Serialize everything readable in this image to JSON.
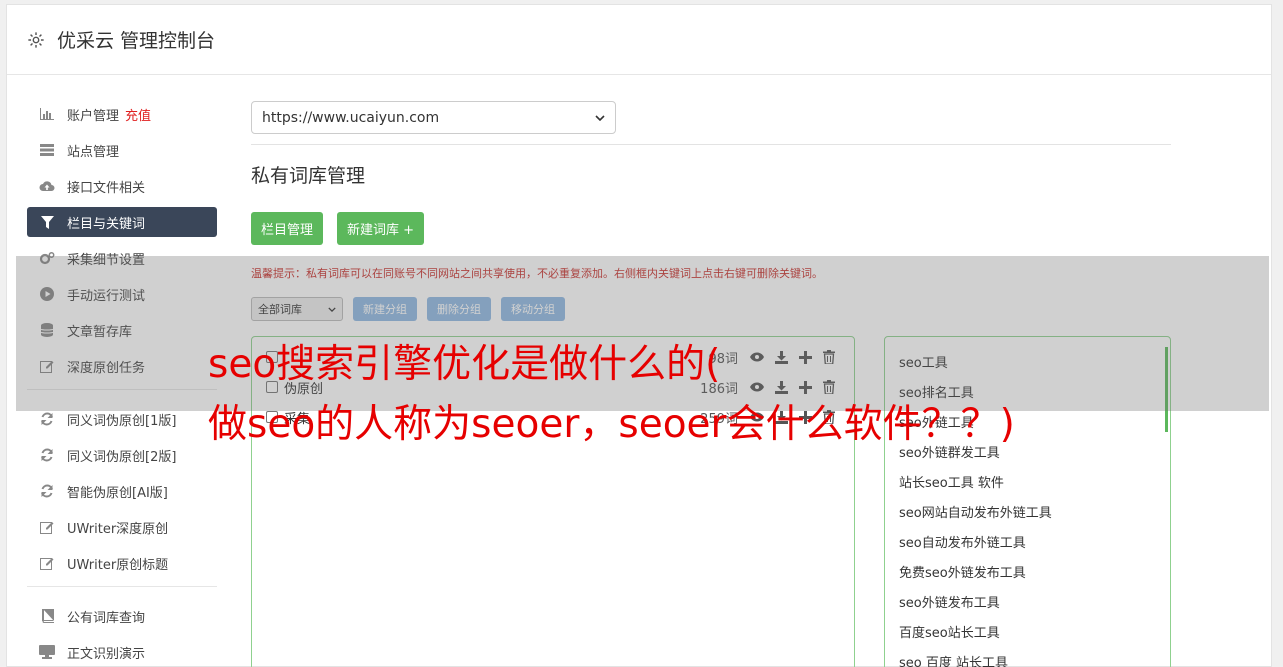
{
  "header": {
    "title": "优采云 管理控制台",
    "icon": "gear-icon"
  },
  "sidebar": {
    "items": [
      {
        "label": "账户管理",
        "badge": "充值",
        "icon": "bar-chart-icon"
      },
      {
        "label": "站点管理",
        "icon": "server-icon"
      },
      {
        "label": "接口文件相关",
        "icon": "cloud-upload-icon"
      },
      {
        "label": "栏目与关键词",
        "icon": "filter-icon",
        "active": true
      },
      {
        "label": "采集细节设置",
        "icon": "cogs-icon"
      },
      {
        "label": "手动运行测试",
        "icon": "play-circle-icon"
      },
      {
        "label": "文章暂存库",
        "icon": "database-icon"
      },
      {
        "label": "深度原创任务",
        "icon": "edit-icon"
      }
    ],
    "items2": [
      {
        "label": "同义词伪原创[1版]",
        "icon": "refresh-icon"
      },
      {
        "label": "同义词伪原创[2版]",
        "icon": "refresh-icon"
      },
      {
        "label": "智能伪原创[AI版]",
        "icon": "refresh-icon"
      },
      {
        "label": "UWriter深度原创",
        "icon": "edit-icon"
      },
      {
        "label": "UWriter原创标题",
        "icon": "edit-icon"
      }
    ],
    "items3": [
      {
        "label": "公有词库查询",
        "icon": "book-icon"
      },
      {
        "label": "正文识别演示",
        "icon": "monitor-icon"
      }
    ]
  },
  "main": {
    "site_select": "https://www.ucaiyun.com",
    "section_title": "私有词库管理",
    "btn_column": "栏目管理",
    "btn_new": "新建词库 +",
    "tip": "温馨提示：私有词库可以在同账号不同网站之间共享使用，不必重复添加。右侧框内关键词上点击右键可删除关键词。",
    "filter_select": "全部词库",
    "btn_new_group": "新建分组",
    "btn_delete_group": "删除分组",
    "btn_move_group": "移动分组",
    "libraries": [
      {
        "name": "",
        "count": "98词"
      },
      {
        "name": "伪原创",
        "count": "186词"
      },
      {
        "name": "采集",
        "count": "259词"
      }
    ],
    "keywords": [
      "seo工具",
      "seo排名工具",
      "seo外链工具",
      "seo外链群发工具",
      "站长seo工具 软件",
      "seo网站自动发布外链工具",
      "seo自动发布外链工具",
      "免费seo外链发布工具",
      "seo外链发布工具",
      "百度seo站长工具",
      "seo 百度 站长工具"
    ]
  },
  "overlay_text": {
    "line1": "seo搜索引擎优化是做什么的(",
    "line2": "做seo的人称为seoer，seoer会什么软件？？)"
  },
  "colors": {
    "active_nav": "#3a4659",
    "green": "#5cb85c",
    "blue_btn": "#8fb9e3",
    "overlay_text": "#e60000"
  }
}
